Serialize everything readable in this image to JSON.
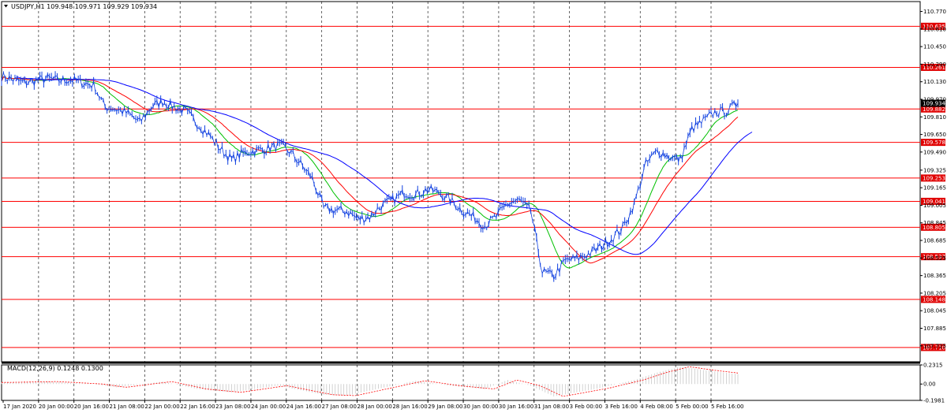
{
  "chart_data": {
    "type": "line",
    "title": "USDJPY,H1  109.948 109.971 109.929 109.934",
    "symbol_menu_icon": "triangle-down-icon",
    "price_axis": {
      "ylim": [
        107.58,
        110.86
      ],
      "ticks": [
        "110.770",
        "110.610",
        "110.450",
        "110.290",
        "110.130",
        "109.970",
        "109.810",
        "109.650",
        "109.490",
        "109.325",
        "109.165",
        "109.005",
        "108.845",
        "108.685",
        "108.525",
        "108.365",
        "108.205",
        "108.045",
        "107.885",
        "107.725"
      ],
      "current_price": "109.934"
    },
    "levels": [
      "110.635",
      "110.261",
      "109.882",
      "109.578",
      "109.253",
      "109.041",
      "108.805",
      "108.537",
      "108.148",
      "107.710"
    ],
    "x_labels": [
      "17 Jan 2020",
      "20 Jan 00:00",
      "20 Jan 16:00",
      "21 Jan 08:00",
      "22 Jan 00:00",
      "22 Jan 16:00",
      "23 Jan 08:00",
      "24 Jan 00:00",
      "24 Jan 16:00",
      "27 Jan 08:00",
      "28 Jan 00:00",
      "28 Jan 16:00",
      "29 Jan 08:00",
      "30 Jan 00:00",
      "30 Jan 16:00",
      "31 Jan 08:00",
      "3 Feb 00:00",
      "3 Feb 16:00",
      "4 Feb 08:00",
      "5 Feb 00:00",
      "5 Feb 16:00"
    ],
    "price_anchors": [
      [
        0,
        110.18
      ],
      [
        1,
        110.15
      ],
      [
        2,
        110.12
      ],
      [
        3,
        110.14
      ],
      [
        4,
        110.16
      ],
      [
        5,
        110.14
      ],
      [
        6,
        110.15
      ],
      [
        7,
        110.12
      ],
      [
        8,
        110.1
      ],
      [
        9,
        109.9
      ],
      [
        10,
        109.88
      ],
      [
        11,
        109.84
      ],
      [
        12,
        109.76
      ],
      [
        13,
        109.9
      ],
      [
        14,
        109.95
      ],
      [
        15,
        109.9
      ],
      [
        16,
        109.86
      ],
      [
        17,
        109.75
      ],
      [
        18,
        109.65
      ],
      [
        19,
        109.52
      ],
      [
        20,
        109.42
      ],
      [
        21,
        109.48
      ],
      [
        22,
        109.5
      ],
      [
        23,
        109.52
      ],
      [
        24,
        109.55
      ],
      [
        25,
        109.5
      ],
      [
        26,
        109.38
      ],
      [
        27,
        109.25
      ],
      [
        28,
        108.98
      ],
      [
        29,
        108.96
      ],
      [
        30,
        108.95
      ],
      [
        31,
        108.88
      ],
      [
        32,
        108.9
      ],
      [
        33,
        109
      ],
      [
        34,
        109.05
      ],
      [
        35,
        109.12
      ],
      [
        36,
        109.1
      ],
      [
        37,
        109.15
      ],
      [
        38,
        109.12
      ],
      [
        39,
        109.05
      ],
      [
        40,
        108.96
      ],
      [
        41,
        108.9
      ],
      [
        42,
        108.82
      ],
      [
        43,
        108.9
      ],
      [
        44,
        109.02
      ],
      [
        45,
        109.05
      ],
      [
        46,
        108.95
      ],
      [
        47,
        108.4
      ],
      [
        48,
        108.36
      ],
      [
        49,
        108.5
      ],
      [
        50,
        108.52
      ],
      [
        51,
        108.56
      ],
      [
        52,
        108.62
      ],
      [
        53,
        108.7
      ],
      [
        54,
        108.8
      ],
      [
        55,
        109.02
      ],
      [
        56,
        109.38
      ],
      [
        57,
        109.5
      ],
      [
        58,
        109.45
      ],
      [
        59,
        109.42
      ],
      [
        60,
        109.7
      ],
      [
        61,
        109.77
      ],
      [
        62,
        109.85
      ],
      [
        63,
        109.86
      ],
      [
        64,
        109.934
      ]
    ],
    "indicators": [
      {
        "color": "#00c000",
        "period": 5
      },
      {
        "color": "#ff0000",
        "period": 9
      },
      {
        "color": "#0000ff",
        "period": 15
      }
    ],
    "price_color": "#1040e0",
    "macd": {
      "label": "MACD(12,26,9) 0.1248 0.1300",
      "ylim": [
        -0.1981,
        0.2315
      ],
      "ticks": [
        "0.2315",
        "0.00",
        "-0.1981"
      ],
      "anchors": [
        [
          0,
          0.02
        ],
        [
          4,
          0.03
        ],
        [
          8,
          0.0
        ],
        [
          10,
          -0.04
        ],
        [
          14,
          0.03
        ],
        [
          17,
          -0.06
        ],
        [
          20,
          -0.1
        ],
        [
          24,
          -0.02
        ],
        [
          28,
          -0.13
        ],
        [
          30,
          -0.14
        ],
        [
          33,
          -0.05
        ],
        [
          36,
          0.04
        ],
        [
          39,
          -0.02
        ],
        [
          42,
          -0.06
        ],
        [
          44,
          0.05
        ],
        [
          46,
          -0.02
        ],
        [
          48,
          -0.15
        ],
        [
          52,
          -0.05
        ],
        [
          55,
          0.05
        ],
        [
          57,
          0.14
        ],
        [
          59,
          0.21
        ],
        [
          61,
          0.17
        ],
        [
          64,
          0.12
        ]
      ],
      "signal_color": "#ff0000",
      "hist_color": "#c0c0c0"
    },
    "grid": true,
    "level_color": "#ff0000",
    "label_bg_color": "#e00000"
  }
}
